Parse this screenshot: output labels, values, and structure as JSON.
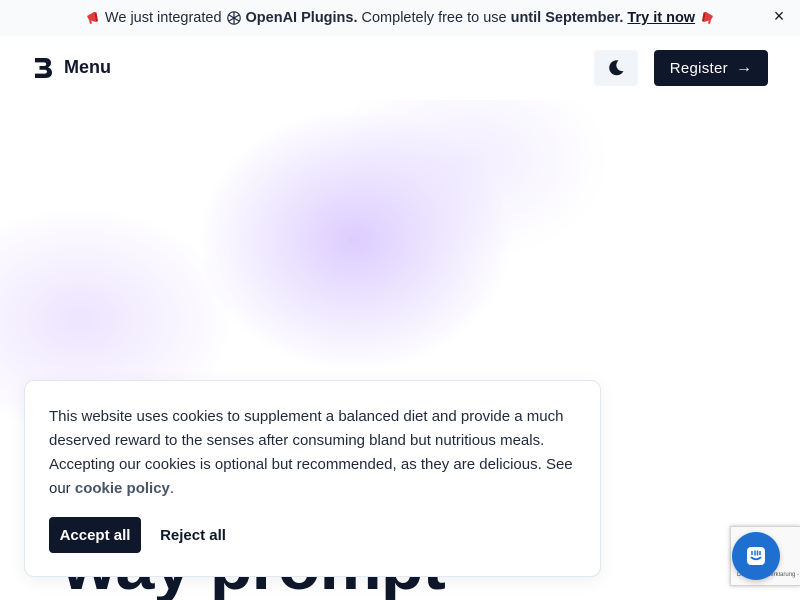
{
  "announcement": {
    "horn_left": "megaphone-icon",
    "text_1": "We just integrated",
    "plugin_icon": "openai-icon",
    "text_plugins": "OpenAI Plugins.",
    "text_2": "Completely free to use",
    "text_until": "until September.",
    "link": "Try it now",
    "horn_right": "megaphone-icon",
    "close": "×"
  },
  "header": {
    "logo_icon": "logo-icon",
    "menu_label": "Menu",
    "theme_icon": "moon-icon",
    "register_label": "Register",
    "register_arrow": "→"
  },
  "hero": {
    "title": "way prompt"
  },
  "cookie": {
    "text": "This website uses cookies to supplement a balanced diet and provide a much deserved reward to the senses after consuming bland but nutritious meals. Accepting our cookies is optional but recommended, as they are delicious. See our ",
    "link": "cookie policy",
    "period": ".",
    "accept": "Accept all",
    "reject": "Reject all"
  },
  "recaptcha": {
    "small_text": "Datenschutzerklärung - Nutzungsbedingungen"
  },
  "chat": {
    "icon": "chat-icon"
  },
  "colors": {
    "primary": "#0f172a",
    "announce_bg": "#f8fafc",
    "theme_btn_bg": "#f1f5f9",
    "chat_blue": "#1f6fd1",
    "glow": "#d6c4ff"
  }
}
